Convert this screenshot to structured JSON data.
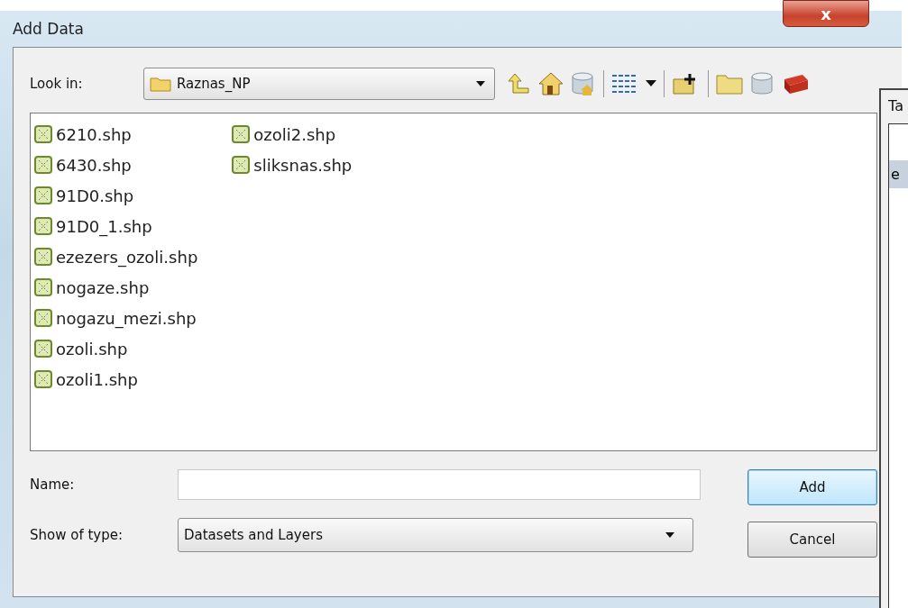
{
  "window": {
    "title": "Add Data",
    "close_glyph": "x"
  },
  "look_in": {
    "label": "Look in:",
    "value": "Raznas_NP"
  },
  "files": [
    {
      "name": "6210.shp"
    },
    {
      "name": "6430.shp"
    },
    {
      "name": "91D0.shp"
    },
    {
      "name": "91D0_1.shp"
    },
    {
      "name": "ezezers_ozoli.shp"
    },
    {
      "name": "nogaze.shp"
    },
    {
      "name": "nogazu_mezi.shp"
    },
    {
      "name": "ozoli.shp"
    },
    {
      "name": "ozoli1.shp"
    },
    {
      "name": "ozoli2.shp"
    },
    {
      "name": "sliksnas.shp"
    }
  ],
  "name_field": {
    "label": "Name:"
  },
  "type_field": {
    "label": "Show of type:",
    "value": "Datasets and Layers"
  },
  "buttons": [
    {
      "label": "Add",
      "default": true
    },
    {
      "label": "Cancel",
      "default": false
    }
  ],
  "background_window": {
    "title": "Ta",
    "row_text": "e"
  }
}
